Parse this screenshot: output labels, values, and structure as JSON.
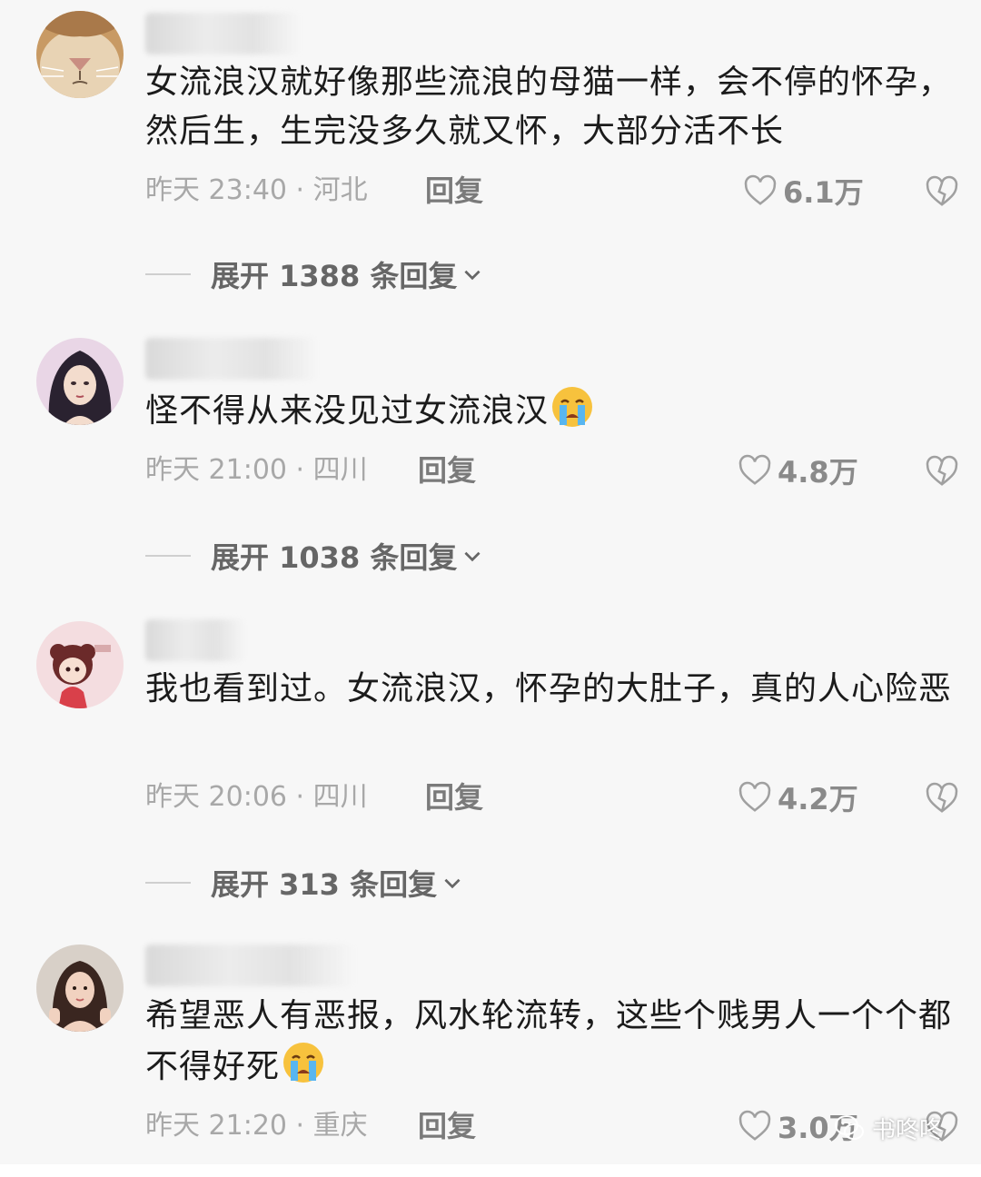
{
  "comments": [
    {
      "text": "女流浪汉就好像那些流浪的母猫一样，会不停的怀孕，然后生，生完没多久就又怀，大部分活不长",
      "meta": "昨天 23:40 · 河北",
      "reply_label": "回复",
      "likes": "6.1万",
      "expand_label": "展开 1388 条回复",
      "avatar_icon": "cat-face-avatar"
    },
    {
      "text": "怪不得从来没见过女流浪汉",
      "meta": "昨天 21:00 · 四川",
      "reply_label": "回复",
      "likes": "4.8万",
      "expand_label": "展开 1038 条回复",
      "avatar_icon": "anime-girl-avatar"
    },
    {
      "text": "我也看到过。女流浪汉，怀孕的大肚子，真的人心险恶",
      "meta": "昨天 20:06 · 四川",
      "reply_label": "回复",
      "likes": "4.2万",
      "expand_label": "展开 313 条回复",
      "avatar_icon": "chibi-girl-avatar"
    },
    {
      "text": "希望恶人有恶报，风水轮流转，这些个贱男人一个个都不得好死",
      "meta": "昨天 21:20 · 重庆",
      "reply_label": "回复",
      "likes": "3.0万",
      "avatar_icon": "woman-photo-avatar"
    }
  ],
  "watermark": {
    "text": "书咚咚",
    "icon": "wechat-icon"
  },
  "colors": {
    "background": "#f7f7f7",
    "text": "#1b1b1b",
    "meta": "#a8a8a8"
  }
}
